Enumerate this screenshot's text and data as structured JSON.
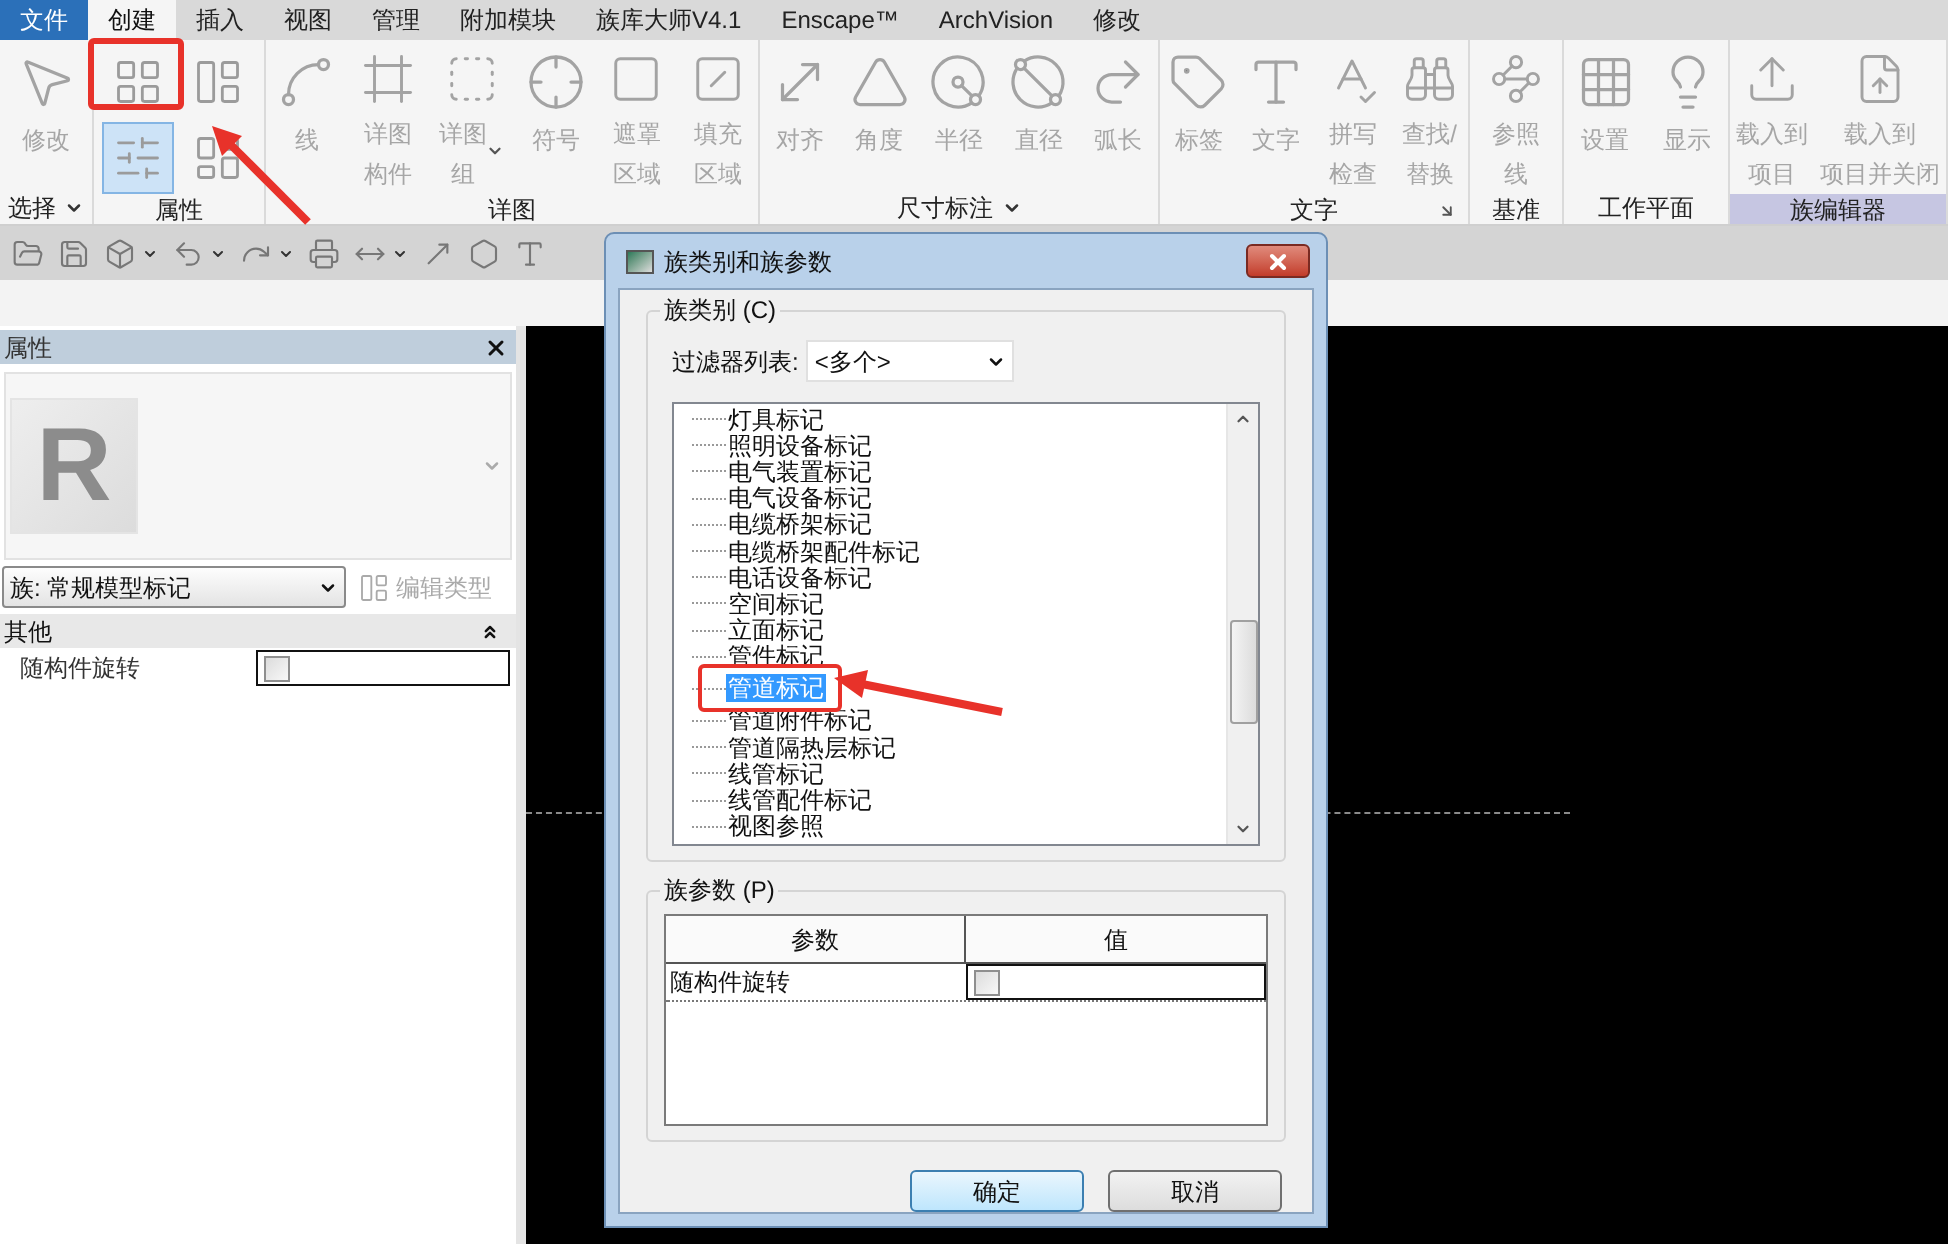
{
  "menu_tabs": [
    {
      "label": "文件",
      "kind": "file",
      "selected": false
    },
    {
      "label": "创建",
      "kind": "tab",
      "selected": true
    },
    {
      "label": "插入",
      "kind": "tab",
      "selected": false
    },
    {
      "label": "视图",
      "kind": "tab",
      "selected": false
    },
    {
      "label": "管理",
      "kind": "tab",
      "selected": false
    },
    {
      "label": "附加模块",
      "kind": "tab",
      "selected": false
    },
    {
      "label": "族库大师V4.1",
      "kind": "tab",
      "selected": false
    },
    {
      "label": "Enscape™",
      "kind": "tab",
      "selected": false
    },
    {
      "label": "ArchVision",
      "kind": "tab",
      "selected": false
    },
    {
      "label": "修改",
      "kind": "tab",
      "selected": false
    }
  ],
  "ribbon": {
    "panels": [
      {
        "label": "选择",
        "dropdown": true,
        "launcher": false,
        "contextual": false,
        "buttons": [
          {
            "kind": "large",
            "lines": [
              "修改"
            ],
            "dropdown": false
          }
        ]
      },
      {
        "label": "属性",
        "dropdown": false,
        "launcher": false,
        "contextual": false,
        "buttons": [
          {
            "kind": "tile",
            "selected": false,
            "highlighted": true
          },
          {
            "kind": "tile",
            "selected": false,
            "highlighted": false
          },
          {
            "kind": "tile",
            "selected": true,
            "highlighted": false
          },
          {
            "kind": "tile",
            "selected": false,
            "highlighted": false
          }
        ]
      },
      {
        "label": "详图",
        "dropdown": false,
        "launcher": false,
        "contextual": false,
        "buttons": [
          {
            "kind": "large",
            "lines": [
              "线"
            ],
            "dropdown": false
          },
          {
            "kind": "large",
            "lines": [
              "详图",
              "构件"
            ],
            "dropdown": false
          },
          {
            "kind": "large",
            "lines": [
              "详图",
              "组"
            ],
            "dropdown": true
          },
          {
            "kind": "large",
            "lines": [
              "符号"
            ],
            "dropdown": false
          },
          {
            "kind": "large",
            "lines": [
              "遮罩",
              "区域"
            ],
            "dropdown": false
          },
          {
            "kind": "large",
            "lines": [
              "填充",
              "区域"
            ],
            "dropdown": false
          }
        ]
      },
      {
        "label": "尺寸标注",
        "dropdown": true,
        "launcher": false,
        "contextual": false,
        "buttons": [
          {
            "kind": "large",
            "lines": [
              "对齐"
            ],
            "dropdown": false
          },
          {
            "kind": "large",
            "lines": [
              "角度"
            ],
            "dropdown": false
          },
          {
            "kind": "large",
            "lines": [
              "半径"
            ],
            "dropdown": false
          },
          {
            "kind": "large",
            "lines": [
              "直径"
            ],
            "dropdown": false
          },
          {
            "kind": "large",
            "lines": [
              "弧长"
            ],
            "dropdown": false
          }
        ]
      },
      {
        "label": "文字",
        "dropdown": false,
        "launcher": true,
        "contextual": false,
        "buttons": [
          {
            "kind": "large",
            "lines": [
              "标签"
            ],
            "dropdown": false
          },
          {
            "kind": "large",
            "lines": [
              "文字"
            ],
            "dropdown": false
          },
          {
            "kind": "large",
            "lines": [
              "拼写",
              "检查"
            ],
            "dropdown": false
          },
          {
            "kind": "large",
            "lines": [
              "查找/",
              "替换"
            ],
            "dropdown": false
          }
        ]
      },
      {
        "label": "基准",
        "dropdown": false,
        "launcher": false,
        "contextual": false,
        "buttons": [
          {
            "kind": "large",
            "lines": [
              "参照",
              "线"
            ],
            "dropdown": false
          }
        ]
      },
      {
        "label": "工作平面",
        "dropdown": false,
        "launcher": false,
        "contextual": false,
        "buttons": [
          {
            "kind": "large",
            "lines": [
              "设置"
            ],
            "dropdown": false
          },
          {
            "kind": "large",
            "lines": [
              "显示"
            ],
            "dropdown": false
          }
        ]
      },
      {
        "label": "族编辑器",
        "dropdown": false,
        "launcher": false,
        "contextual": true,
        "buttons": [
          {
            "kind": "large",
            "lines": [
              "载入到",
              "项目"
            ],
            "dropdown": false
          },
          {
            "kind": "large",
            "lines": [
              "载入到",
              "项目并关闭"
            ],
            "dropdown": false
          }
        ]
      }
    ]
  },
  "properties_panel": {
    "title": "属性",
    "preview": {
      "logo": "R"
    },
    "type_selector": "族: 常规模型标记",
    "edit_type_button": {
      "label": "编辑类型",
      "disabled": true
    },
    "groups": [
      {
        "label": "其他",
        "expanded": true,
        "rows": [
          {
            "name": "随构件旋转",
            "checked": false
          }
        ]
      }
    ]
  },
  "dialog": {
    "title": "族类别和族参数",
    "category_group": {
      "label": "族类别 (C)",
      "filter_label": "过滤器列表:",
      "filter_value": "<多个>",
      "items": [
        {
          "label": "灯具标记",
          "selected": false,
          "highlighted": false
        },
        {
          "label": "照明设备标记",
          "selected": false,
          "highlighted": false
        },
        {
          "label": "电气装置标记",
          "selected": false,
          "highlighted": false
        },
        {
          "label": "电气设备标记",
          "selected": false,
          "highlighted": false
        },
        {
          "label": "电缆桥架标记",
          "selected": false,
          "highlighted": false
        },
        {
          "label": "电缆桥架配件标记",
          "selected": false,
          "highlighted": false
        },
        {
          "label": "电话设备标记",
          "selected": false,
          "highlighted": false
        },
        {
          "label": "空间标记",
          "selected": false,
          "highlighted": false
        },
        {
          "label": "立面标记",
          "selected": false,
          "highlighted": false
        },
        {
          "label": "管件标记",
          "selected": false,
          "highlighted": false
        },
        {
          "label": "管道标记",
          "selected": true,
          "highlighted": true
        },
        {
          "label": "管道附件标记",
          "selected": false,
          "highlighted": false
        },
        {
          "label": "管道隔热层标记",
          "selected": false,
          "highlighted": false
        },
        {
          "label": "线管标记",
          "selected": false,
          "highlighted": false
        },
        {
          "label": "线管配件标记",
          "selected": false,
          "highlighted": false
        },
        {
          "label": "视图参照",
          "selected": false,
          "highlighted": false
        }
      ]
    },
    "parameters_group": {
      "label": "族参数 (P)",
      "columns": [
        "参数",
        "值"
      ],
      "rows": [
        {
          "name": "随构件旋转",
          "checked": false
        }
      ]
    },
    "buttons": [
      {
        "label": "确定",
        "default": true
      },
      {
        "label": "取消",
        "default": false
      }
    ]
  }
}
